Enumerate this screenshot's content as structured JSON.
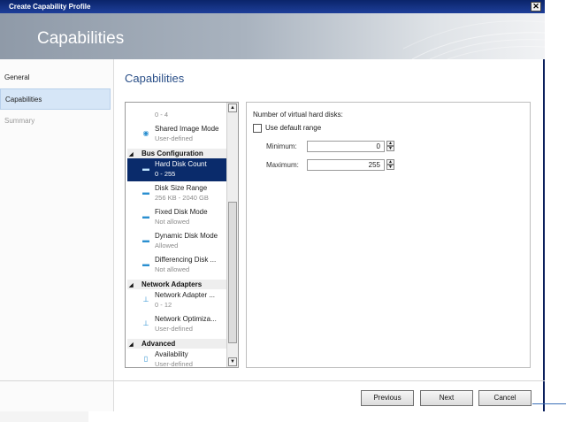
{
  "window": {
    "title": "Create Capability Profile",
    "close_glyph": "✕"
  },
  "banner": {
    "title": "Capabilities"
  },
  "nav": [
    {
      "label": "General",
      "state": "normal"
    },
    {
      "label": "Capabilities",
      "state": "selected"
    },
    {
      "label": "Summary",
      "state": "disabled"
    }
  ],
  "heading": "Capabilities",
  "capabilities": {
    "items": [
      {
        "kind": "entry",
        "name": "",
        "value": "0 - 4",
        "icon": ""
      },
      {
        "kind": "entry",
        "name": "Shared Image Mode",
        "value": "User-defined",
        "icon": "disc-icon"
      },
      {
        "kind": "group",
        "name": "Bus Configuration"
      },
      {
        "kind": "entry",
        "name": "Hard Disk Count",
        "value": "0 - 255",
        "icon": "disk-icon",
        "selected": true
      },
      {
        "kind": "entry",
        "name": "Disk Size Range",
        "value": "256 KB - 2040 GB",
        "icon": "disk-icon"
      },
      {
        "kind": "entry",
        "name": "Fixed Disk Mode",
        "value": "Not allowed",
        "icon": "disk-icon"
      },
      {
        "kind": "entry",
        "name": "Dynamic Disk Mode",
        "value": "Allowed",
        "icon": "disk-icon"
      },
      {
        "kind": "entry",
        "name": "Differencing Disk ...",
        "value": "Not allowed",
        "icon": "disk-icon"
      },
      {
        "kind": "group",
        "name": "Network Adapters"
      },
      {
        "kind": "entry",
        "name": "Network Adapter ...",
        "value": "0 - 12",
        "icon": "network-icon"
      },
      {
        "kind": "entry",
        "name": "Network Optimiza...",
        "value": "User-defined",
        "icon": "network-icon"
      },
      {
        "kind": "group",
        "name": "Advanced"
      },
      {
        "kind": "entry",
        "name": "Availability",
        "value": "User-defined",
        "icon": "server-icon"
      }
    ]
  },
  "detail": {
    "label": "Number of virtual hard disks:",
    "use_default_label": "Use default range",
    "use_default_checked": false,
    "minimum_label": "Minimum:",
    "minimum_value": "0",
    "maximum_label": "Maximum:",
    "maximum_value": "255"
  },
  "buttons": {
    "previous": "Previous",
    "next": "Next",
    "cancel": "Cancel"
  }
}
